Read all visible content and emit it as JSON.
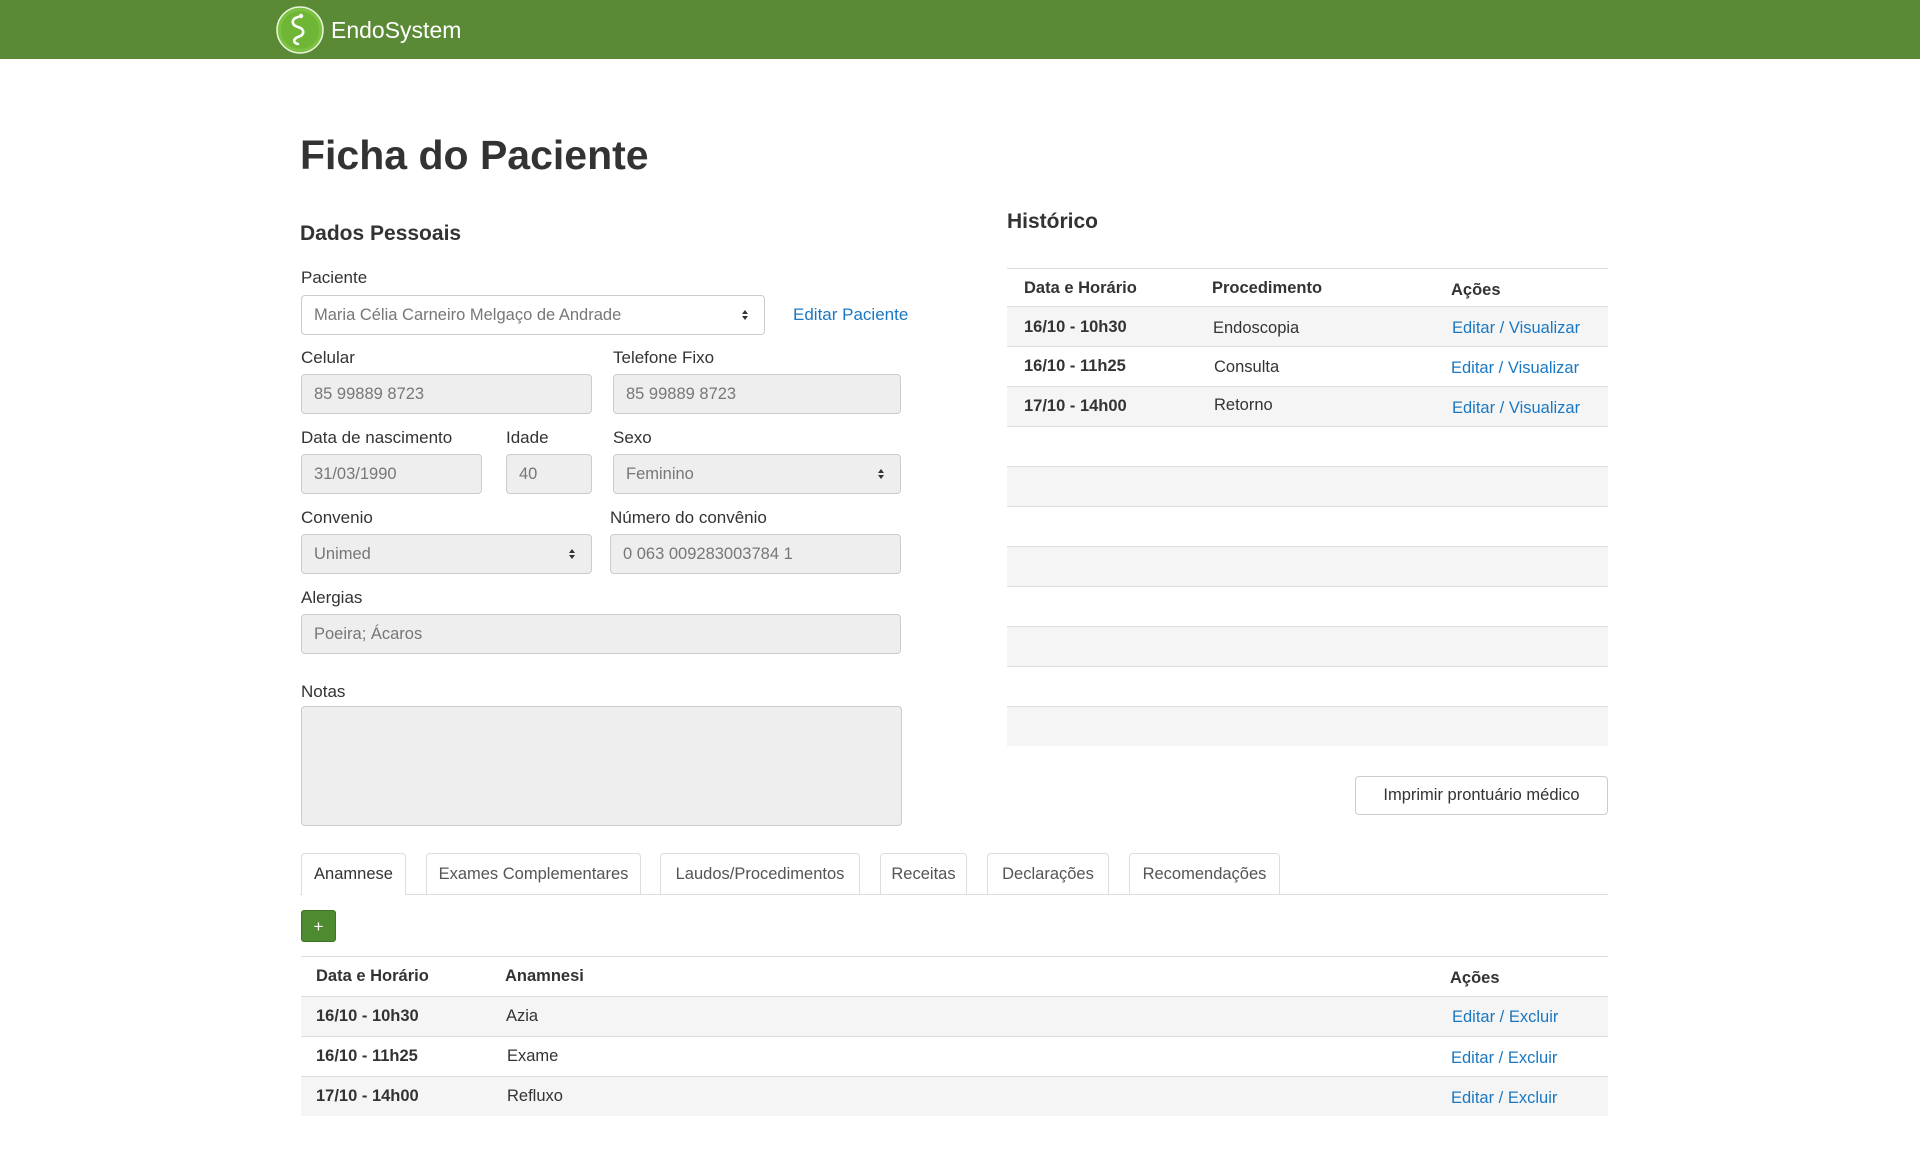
{
  "app": {
    "name": "EndoSystem"
  },
  "page": {
    "title": "Ficha do Paciente"
  },
  "personal": {
    "title": "Dados Pessoais",
    "patient_label": "Paciente",
    "patient_value": "Maria Célia Carneiro Melgaço de Andrade",
    "edit_patient": "Editar Paciente",
    "cell_label": "Celular",
    "cell_value": "85 99889 8723",
    "phone_label": "Telefone Fixo",
    "phone_value": "85 99889 8723",
    "birth_label": "Data de nascimento",
    "birth_value": "31/03/1990",
    "age_label": "Idade",
    "age_value": "40",
    "sex_label": "Sexo",
    "sex_value": "Feminino",
    "insurance_label": "Convenio",
    "insurance_value": "Unimed",
    "insurance_number_label": "Número do convênio",
    "insurance_number_value": "0 063 009283003784 1",
    "allergies_label": "Alergias",
    "allergies_value": "Poeira; Ácaros",
    "notes_label": "Notas",
    "notes_value": ""
  },
  "history": {
    "title": "Histórico",
    "headers": [
      "Data e Horário",
      "Procedimento",
      "Ações"
    ],
    "rows": [
      {
        "date": "16/10 - 10h30",
        "procedure": "Endoscopia",
        "action": "Editar / Visualizar"
      },
      {
        "date": "16/10 - 11h25",
        "procedure": "Consulta",
        "action": "Editar / Visualizar"
      },
      {
        "date": "17/10 - 14h00",
        "procedure": "Retorno",
        "action": "Editar / Visualizar"
      }
    ],
    "print_button": "Imprimir prontuário médico"
  },
  "tabs": [
    "Anamnese",
    "Exames Complementares",
    "Laudos/Procedimentos",
    "Receitas",
    "Declarações",
    "Recomendações"
  ],
  "add_button": "+",
  "anamnese": {
    "headers": [
      "Data e Horário",
      "Anamnesi",
      "Ações"
    ],
    "rows": [
      {
        "date": "16/10 - 10h30",
        "text": "Azia",
        "action": "Editar / Excluir"
      },
      {
        "date": "16/10 - 11h25",
        "text": "Exame",
        "action": "Editar / Excluir"
      },
      {
        "date": "17/10 - 14h00",
        "text": "Refluxo",
        "action": "Editar / Excluir"
      }
    ]
  },
  "colors": {
    "navbar": "#5a8a35",
    "link": "#1a78c2",
    "add_button": "#4e8a2f"
  },
  "icons": {
    "logo": "endosystem-logo-icon",
    "select_caret": "select-caret-icon"
  }
}
